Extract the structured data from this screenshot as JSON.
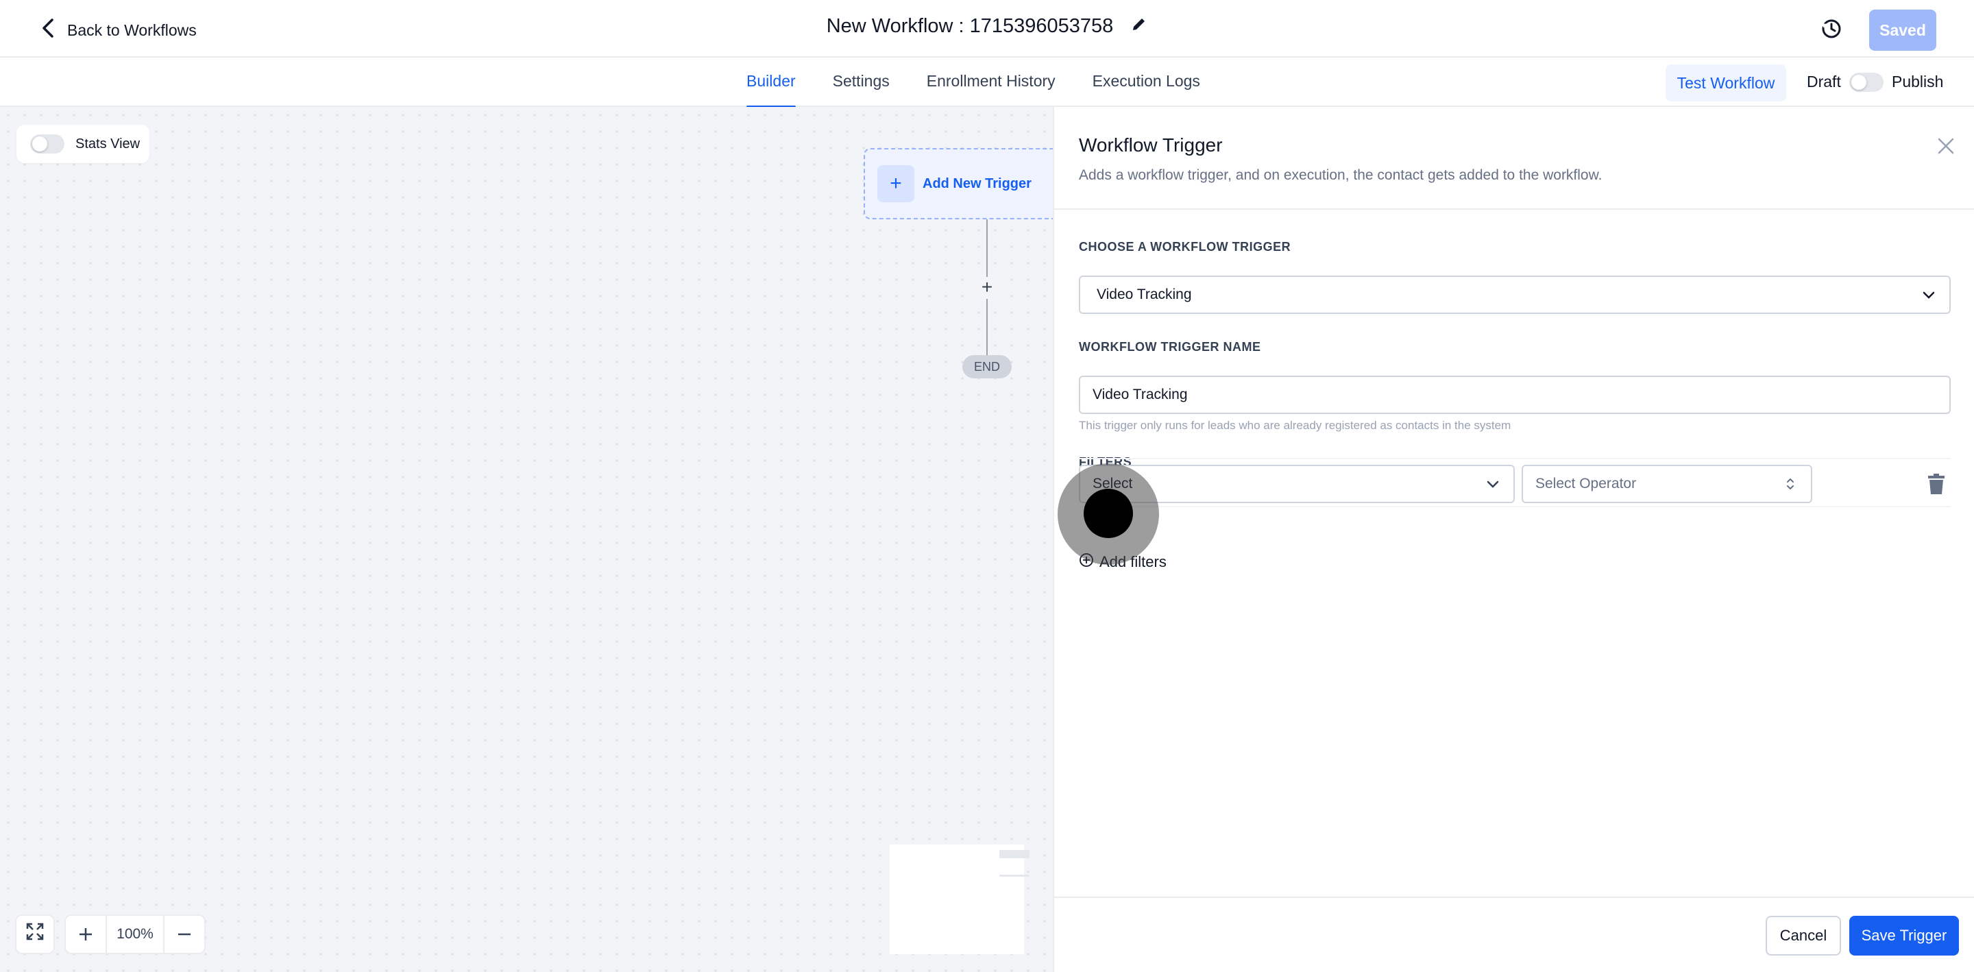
{
  "header": {
    "back_label": "Back to Workflows",
    "workflow_title": "New Workflow : 1715396053758",
    "saved_label": "Saved"
  },
  "tabs": [
    {
      "label": "Builder",
      "active": true
    },
    {
      "label": "Settings",
      "active": false
    },
    {
      "label": "Enrollment History",
      "active": false
    },
    {
      "label": "Execution Logs",
      "active": false
    }
  ],
  "actions": {
    "test_label": "Test Workflow",
    "draft_label": "Draft",
    "publish_label": "Publish",
    "publish_on": false
  },
  "canvas": {
    "stats_view_label": "Stats View",
    "stats_view_on": false,
    "trigger_node_label": "Add New Trigger",
    "connector_add": "+",
    "end_label": "END",
    "zoom_level": "100%"
  },
  "panel": {
    "title": "Workflow Trigger",
    "subtitle": "Adds a workflow trigger, and on execution, the contact gets added to the workflow.",
    "choose_label": "CHOOSE A WORKFLOW TRIGGER",
    "trigger_value": "Video Tracking",
    "name_label": "WORKFLOW TRIGGER NAME",
    "name_value": "Video Tracking",
    "name_hint": "This trigger only runs for leads who are already registered as contacts in the system",
    "filters_label": "FILTERS",
    "filter_field_value": "Select",
    "filter_operator_placeholder": "Select Operator",
    "add_filters_label": "Add filters",
    "cancel_label": "Cancel",
    "save_label": "Save Trigger"
  },
  "colors": {
    "accent": "#155eef",
    "saved_disabled": "#9fb8f9",
    "canvas_bg": "#f2f4f7"
  }
}
